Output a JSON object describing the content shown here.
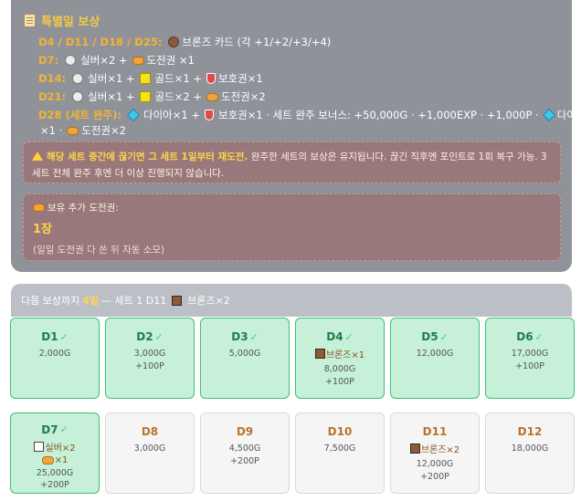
{
  "special": {
    "title": "특별일 보상",
    "lines": {
      "d4_label": "D4 / D11 / D18 / D25:",
      "d4_text": "브론즈 카드 (각 +1/+2/+3/+4)",
      "d7_label": "D7:",
      "d7_silver": "실버×2 +",
      "d7_ticket": "도전권 ×1",
      "d14_label": "D14:",
      "d14_silver": "실버×1 +",
      "d14_gold": "골드×1 +",
      "d14_shield": "보호권×1",
      "d21_label": "D21:",
      "d21_silver": "실버×1 +",
      "d21_gold": "골드×2 +",
      "d21_ticket": "도전권×2",
      "d28_label": "D28 (세트 완주):",
      "d28_diamond": "다이아×1 +",
      "d28_shield": "보호권×1 · 세트 완주 보너스: +50,000G · +1,000EXP · +1,000P ·",
      "d28_diamond2": "다이아",
      "d28_cont": "×1 ·",
      "d28_ticket": "도전권×2"
    },
    "warning": {
      "strong": "해당 세트 중간에 끊기면 그 세트 1일부터 재도전.",
      "text": " 완주한 세트의 보상은 유지됩니다. 끊긴 직후엔 포인트로 1회 복구 가능. 3세트 전체 완주 후엔 더 이상 진행되지 않습니다."
    },
    "holding": {
      "label": "보유 추가 도전권:",
      "count": "1장",
      "note": "(일일 도전권 다 쓴 뒤 자동 소모)"
    }
  },
  "next": {
    "prefix": "다음 보상까지",
    "days": "4일",
    "suffix": "— 세트 1 D11",
    "item": "브론즈×2"
  },
  "days": [
    {
      "label": "D1",
      "check": "✓",
      "gold": "2,000G"
    },
    {
      "label": "D2",
      "check": "✓",
      "gold": "3,000G",
      "point": "+100P"
    },
    {
      "label": "D3",
      "check": "✓",
      "gold": "5,000G"
    },
    {
      "label": "D4",
      "check": "✓",
      "item": "브론즈×1",
      "gold": "8,000G",
      "point": "+100P"
    },
    {
      "label": "D5",
      "check": "✓",
      "gold": "12,000G"
    },
    {
      "label": "D6",
      "check": "✓",
      "gold": "17,000G",
      "point": "+100P"
    },
    {
      "label": "D7",
      "check": "✓",
      "item": "실버×2",
      "item2": "×1",
      "gold": "25,000G",
      "point": "+200P"
    },
    {
      "label": "D8",
      "gold": "3,000G"
    },
    {
      "label": "D9",
      "gold": "4,500G",
      "point": "+200P"
    },
    {
      "label": "D10",
      "gold": "7,500G"
    },
    {
      "label": "D11",
      "item": "브론즈×2",
      "gold": "12,000G",
      "point": "+200P"
    },
    {
      "label": "D12",
      "gold": "18,000G"
    }
  ],
  "colors": {
    "panel": "#8f9299",
    "accent_gold": "#f6c945",
    "label_orange": "#f3b432",
    "done_bg": "#c6f0d8",
    "done_border": "#3fbf7a",
    "future_title": "#b8742a"
  },
  "icons": [
    "scroll-icon",
    "bronze-card-icon",
    "silver-coin-icon",
    "gold-box-icon",
    "ticket-icon",
    "shield-icon",
    "diamond-icon",
    "warning-icon",
    "check-icon"
  ]
}
